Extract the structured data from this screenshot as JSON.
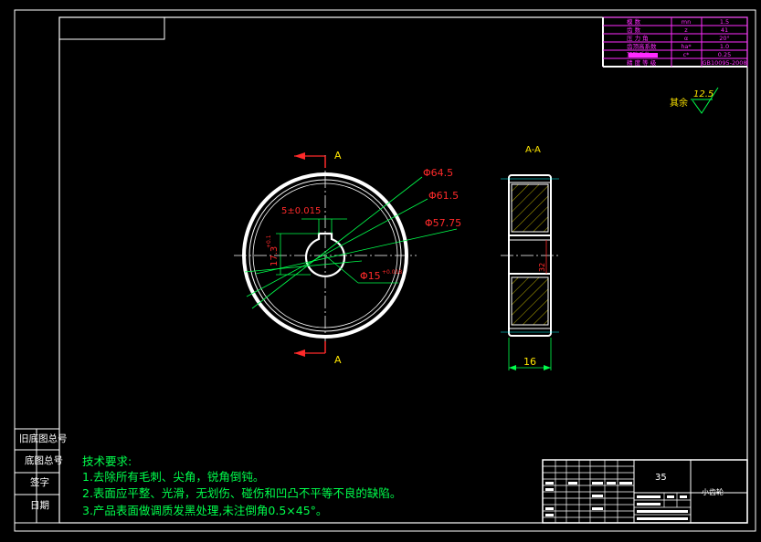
{
  "drawing": {
    "title_block": {
      "scale_number": "35",
      "part_name": "小齿轮"
    },
    "side_labels": [
      "旧底图总号",
      "底图总号",
      "签字",
      "日期"
    ],
    "section_label": "A",
    "section_view_title": "A-A",
    "surface_note": {
      "label": "其余",
      "roughness": "12.5"
    },
    "dimensions": {
      "d_outer": "Φ64.5",
      "d_pitch": "Φ61.5",
      "d_root": "Φ57.75",
      "key_width": "5±0.015",
      "key_depth": "17.3",
      "key_tol": "+0.1",
      "bore": "Φ15",
      "bore_tol": "+0.018",
      "face_width": "16",
      "hub_label": "32"
    },
    "gear_table": [
      {
        "name": "模 数",
        "sym": "mn",
        "val": "1.5"
      },
      {
        "name": "齿 数",
        "sym": "z",
        "val": "41"
      },
      {
        "name": "压 力 角",
        "sym": "α",
        "val": "20°"
      },
      {
        "name": "齿顶高系数",
        "sym": "ha*",
        "val": "1.0"
      },
      {
        "name": "顶隙系数",
        "sym": "c*",
        "val": "0.25"
      },
      {
        "name": "精 度 等 级",
        "sym": "",
        "val": "GB10095-2008"
      }
    ],
    "technical_requirements": {
      "title": "技术要求:",
      "items": [
        "1.去除所有毛刺、尖角，锐角倒钝。",
        "2.表面应平整、光滑，无划伤、碰伤和凹凸不平等不良的缺陷。",
        "3.产品表面做调质发黑处理,未注倒角0.5×45°。"
      ]
    },
    "colors": {
      "frame": "#ffffff",
      "dimension": "#ff2a2a",
      "leader": "#00ff4c",
      "text_yellow": "#ffe600",
      "hatch": "#ffe600",
      "table": "#ff2bff"
    }
  }
}
